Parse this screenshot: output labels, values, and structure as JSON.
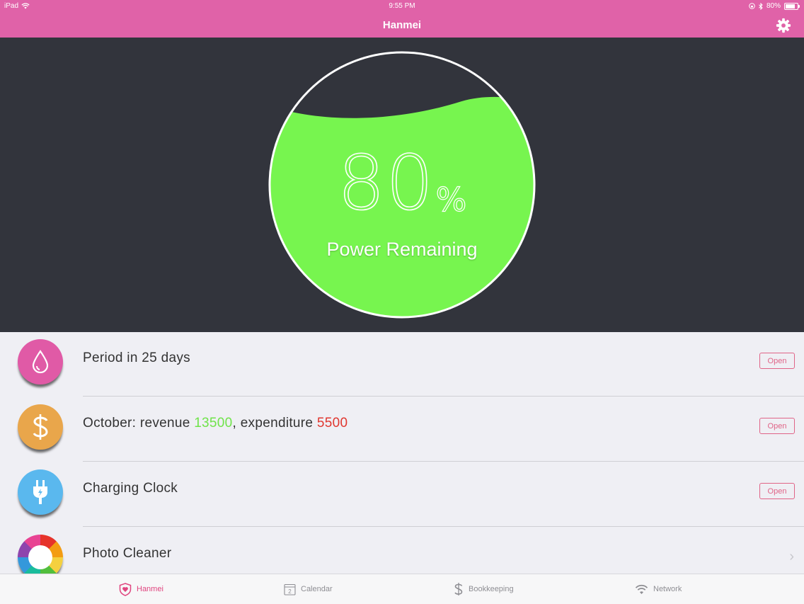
{
  "status_bar": {
    "carrier": "iPad",
    "time": "9:55 PM",
    "battery_percent_text": "80%",
    "battery_level": 0.8
  },
  "nav": {
    "title": "Hanmei",
    "settings_icon": "gear-icon"
  },
  "gauge": {
    "value": "80",
    "unit": "%",
    "label": "Power Remaining",
    "level": 0.8,
    "fill_color": "#77f54f"
  },
  "rows": [
    {
      "icon": "drop-icon",
      "icon_color": "#e05aa6",
      "label": "Period in 25 days",
      "action": "Open"
    },
    {
      "icon": "dollar-icon",
      "icon_color": "#e9a64b",
      "label_parts": [
        "October: revenue ",
        "13500",
        ", expenditure ",
        "5500"
      ],
      "revenue_color": "#6fe34a",
      "expenditure_color": "#e0372f",
      "action": "Open"
    },
    {
      "icon": "plug-icon",
      "icon_color": "#5ab8ee",
      "label": "Charging Clock",
      "action": "Open"
    },
    {
      "icon": "photo-wheel-icon",
      "label": "Photo Cleaner",
      "action_icon": "chevron-right-icon"
    }
  ],
  "tabs": [
    {
      "label": "Hanmei",
      "icon": "heart-shield-icon",
      "active": true
    },
    {
      "label": "Calendar",
      "icon": "calendar-icon",
      "calendar_day": "2",
      "active": false
    },
    {
      "label": "Bookkeeping",
      "icon": "dollar-sign-icon",
      "active": false
    },
    {
      "label": "Network",
      "icon": "wifi-icon",
      "active": false
    }
  ],
  "colors": {
    "brand": "#e062a8",
    "hero_bg": "#32343c",
    "accent": "#e06487"
  }
}
